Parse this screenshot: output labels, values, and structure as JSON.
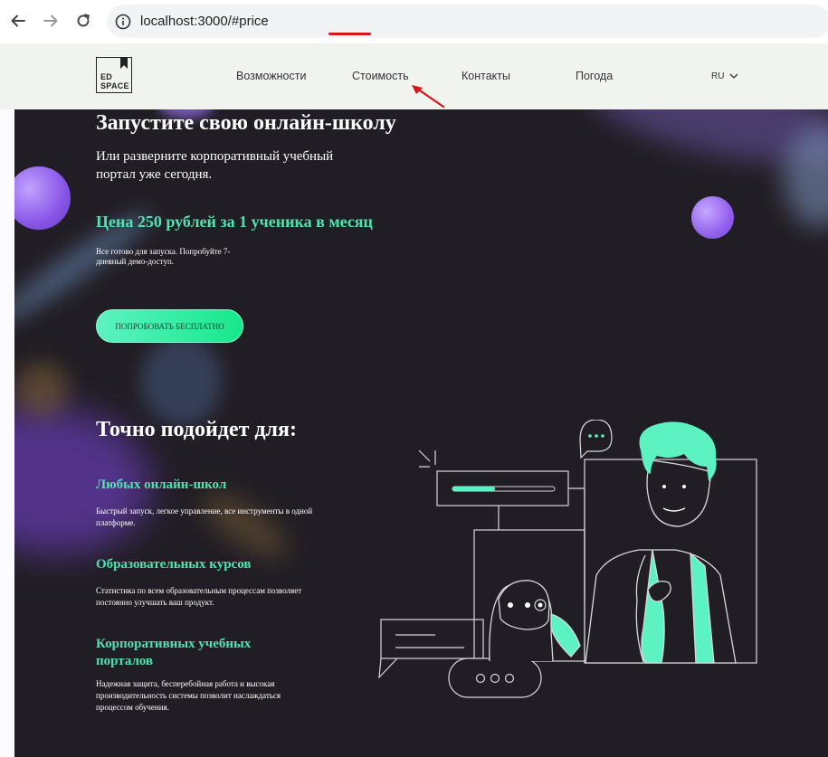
{
  "browser": {
    "url": "localhost:3000/#price",
    "back_icon": "arrow-left-icon",
    "forward_icon": "arrow-right-icon",
    "reload_icon": "reload-icon",
    "info_icon": "info-icon"
  },
  "header": {
    "logo_line1": "ED",
    "logo_line2": "SPACE",
    "nav": [
      "Возможности",
      "Стоимость",
      "Контакты",
      "Погода"
    ],
    "lang": "RU"
  },
  "hero": {
    "title": "Запустите свою онлайн-школу",
    "subtitle": "Или разверните корпоративный учебный портал уже сегодня.",
    "price": "Цена 250 рублей за 1 ученика в месяц",
    "price_note": "Все готово для запуска. Попробуйте 7-дневный демо-доступ.",
    "cta": "ПОПРОБОВАТЬ БЕСПЛАТНО"
  },
  "fit": {
    "title": "Точно подойдет для:",
    "items": [
      {
        "title": "Любых онлайн-школ",
        "text": "Быстрый запуск, легкое управление, все инструменты в одной платформе."
      },
      {
        "title": "Образовательных курсов",
        "text": "Статистика по всем образовательным процессам позволяет постоянно улучшать ваш продукт."
      },
      {
        "title": "Корпоративных учебных порталов",
        "text": "Надежная защита, бесперебойная работа и высокая производительность системы позволит наслаждаться процессом обучения."
      }
    ]
  },
  "colors": {
    "accent": "#4fe3b0",
    "hero_bg": "#211d24",
    "header_bg": "#f1f3ee",
    "purple": "#9b6bf2"
  }
}
